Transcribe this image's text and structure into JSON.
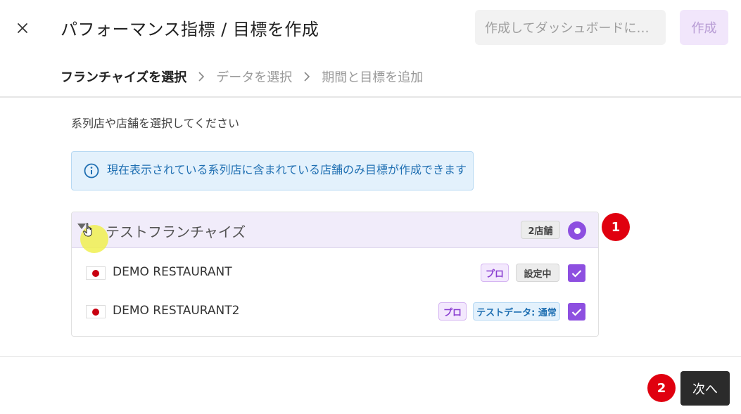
{
  "header": {
    "title": "パフォーマンス指標 / 目標を作成",
    "add_dashboard_label": "作成してダッシュボードに追加...",
    "create_label": "作成"
  },
  "steps": [
    {
      "label": "フランチャイズを選択",
      "active": true
    },
    {
      "label": "データを選択",
      "active": false
    },
    {
      "label": "期間と目標を追加",
      "active": false
    }
  ],
  "instruction": "系列店や店舗を選択してください",
  "info": {
    "text": "現在表示されている系列店に含まれている店舗のみ目標が作成できます"
  },
  "franchise": {
    "name": "テストフランチャイズ",
    "store_count": "2店舗",
    "selected": true,
    "stores": [
      {
        "name": "DEMO RESTAURANT",
        "badges": [
          "プロ",
          "設定中"
        ],
        "checked": true
      },
      {
        "name": "DEMO RESTAURANT2",
        "badges": [
          "プロ",
          "テストデータ: 通常"
        ],
        "checked": true
      }
    ]
  },
  "markers": [
    "1",
    "2"
  ],
  "footer": {
    "next_label": "次へ"
  },
  "colors": {
    "accent": "#8d4fe0",
    "info_bg": "#e3f1fc",
    "info_text": "#1f6fb2",
    "marker": "#e0000f",
    "next_button": "#2b2b2b"
  }
}
